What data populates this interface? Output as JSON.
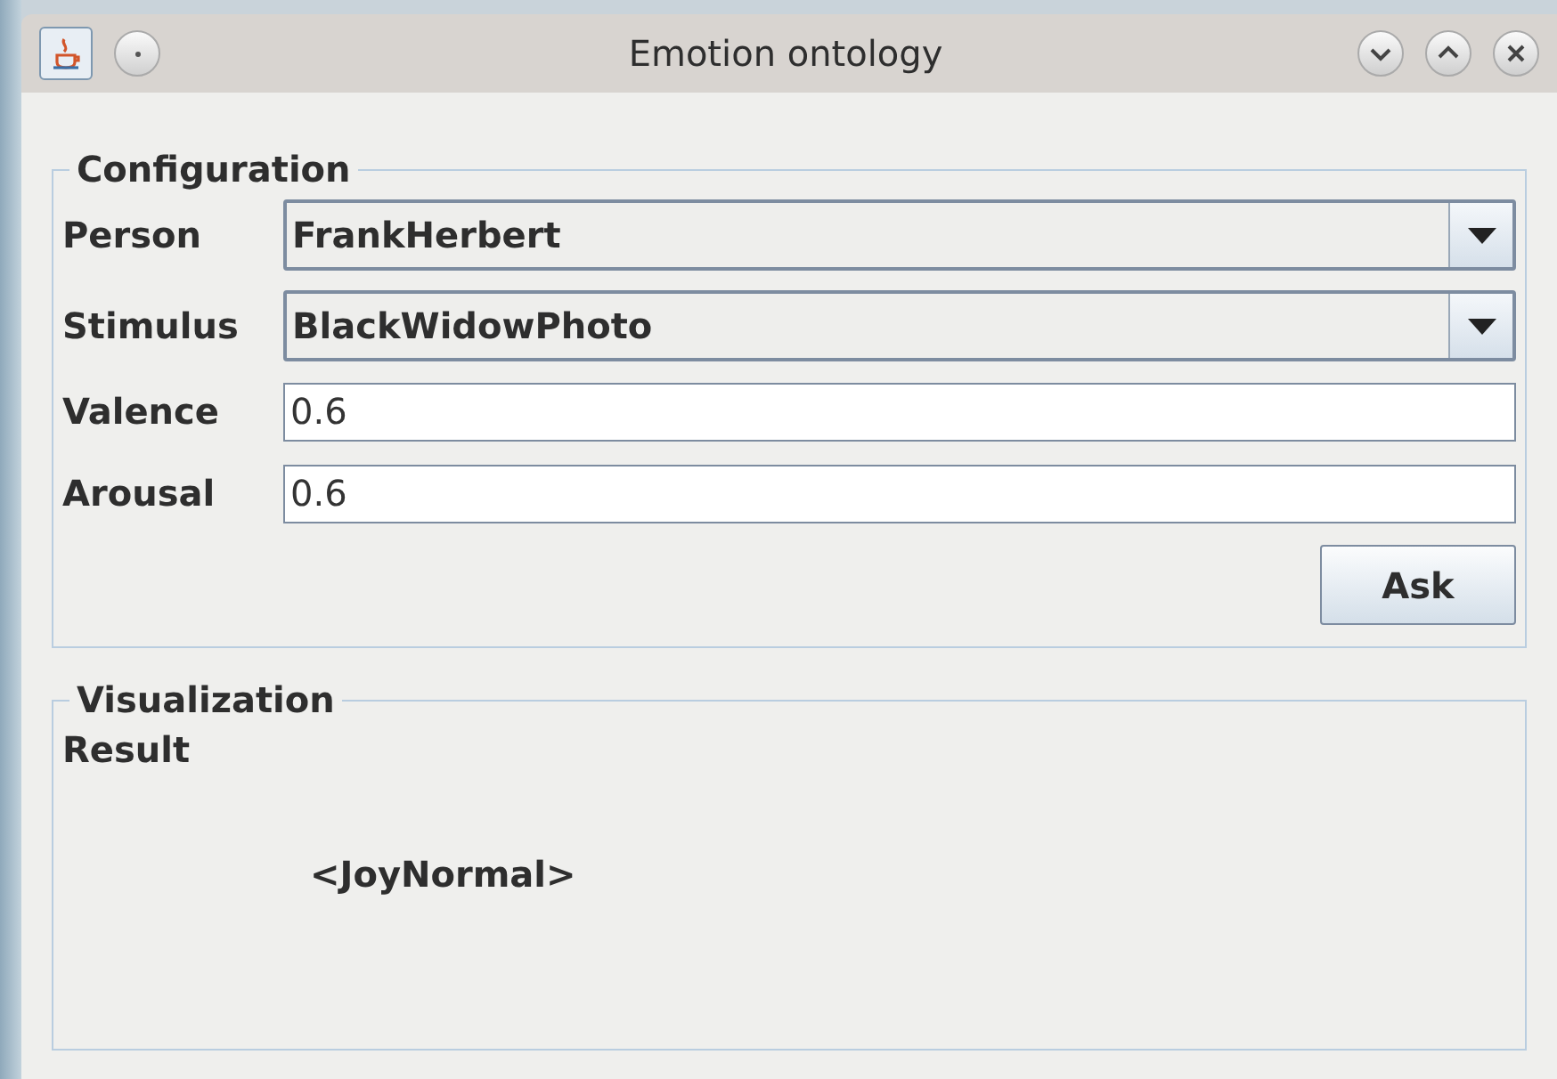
{
  "window": {
    "title": "Emotion ontology"
  },
  "configuration": {
    "title": "Configuration",
    "fields": [
      {
        "kind": "combo",
        "label": "Person",
        "value": "FrankHerbert"
      },
      {
        "kind": "combo",
        "label": "Stimulus",
        "value": "BlackWidowPhoto"
      },
      {
        "kind": "text",
        "label": "Valence",
        "value": "0.6"
      },
      {
        "kind": "text",
        "label": "Arousal",
        "value": "0.6"
      }
    ],
    "button": "Ask"
  },
  "visualization": {
    "title": "Visualization",
    "label": "Result",
    "result": "<JoyNormal>"
  }
}
